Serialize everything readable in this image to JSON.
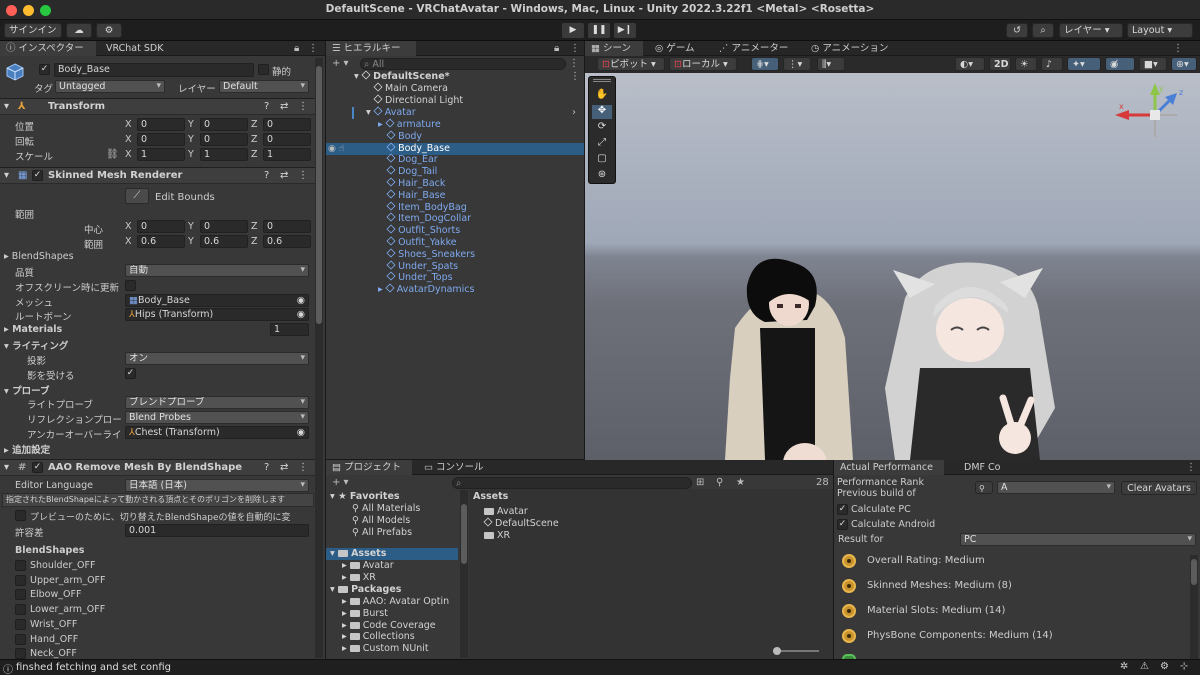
{
  "window": {
    "title": "DefaultScene - VRChatAvatar - Windows, Mac, Linux - Unity 2022.3.22f1 <Metal> <Rosetta>"
  },
  "toolbar": {
    "signin": "サインイン",
    "layers": "レイヤー",
    "layout": "Layout"
  },
  "inspector": {
    "tabs": [
      "インスペクター",
      "VRChat SDK"
    ],
    "object_name": "Body_Base",
    "static_label": "静的",
    "tag_label": "タグ",
    "tag_value": "Untagged",
    "layer_label": "レイヤー",
    "layer_value": "Default",
    "transform": {
      "title": "Transform",
      "rows": [
        {
          "label": "位置",
          "x": "0",
          "y": "0",
          "z": "0"
        },
        {
          "label": "回転",
          "x": "0",
          "y": "0",
          "z": "0"
        },
        {
          "label": "スケール",
          "x": "1",
          "y": "1",
          "z": "1"
        }
      ],
      "axis": [
        "X",
        "Y",
        "Z"
      ]
    },
    "smr": {
      "title": "Skinned Mesh Renderer",
      "edit_bounds": "Edit Bounds",
      "bounds_label": "範囲",
      "center_label": "中心",
      "center": [
        "0",
        "0",
        "0"
      ],
      "extent_label": "範囲",
      "extent": [
        "0.6",
        "0.6",
        "0.6"
      ],
      "blendshapes": "BlendShapes",
      "quality_label": "品質",
      "quality_value": "自動",
      "offscreen_label": "オフスクリーン時に更新",
      "mesh_label": "メッシュ",
      "mesh_value": "Body_Base",
      "rootbone_label": "ルートボーン",
      "rootbone_value": "Hips (Transform)",
      "materials_label": "Materials",
      "materials_count": "1",
      "lighting_label": "ライティング",
      "cast_label": "投影",
      "cast_value": "オン",
      "receive_label": "影を受ける",
      "probes_label": "プローブ",
      "lightprobe_label": "ライトプローブ",
      "lightprobe_value": "ブレンドプローブ",
      "reflection_label": "リフレクションプロー",
      "reflection_value": "Blend Probes",
      "anchor_label": "アンカーオーバーライ",
      "anchor_value": "Chest (Transform)",
      "extra_label": "追加設定"
    },
    "aao": {
      "title": "AAO Remove Mesh By BlendShape",
      "lang_label": "Editor Language",
      "lang_value": "日本語 (日本)",
      "info": "指定されたBlendShapeによって動かされる頂点とそのポリゴンを削除します",
      "preview": "プレビューのために、切り替えたBlendShapeの値を自動的に変",
      "tolerance_label": "許容差",
      "tolerance_value": "0.001",
      "blendshapes_label": "BlendShapes",
      "items": [
        "Shoulder_OFF",
        "Upper_arm_OFF",
        "Elbow_OFF",
        "Lower_arm_OFF",
        "Wrist_OFF",
        "Hand_OFF",
        "Neck_OFF"
      ]
    }
  },
  "hierarchy": {
    "tab": "ヒエラルキー",
    "search_placeholder": "All",
    "scene": "DefaultScene*",
    "items": [
      "Main Camera",
      "Directional Light"
    ],
    "avatar": "Avatar",
    "children": [
      "armature",
      "Body",
      "Body_Base",
      "Dog_Ear",
      "Dog_Tail",
      "Hair_Back",
      "Hair_Base",
      "Item_BodyBag",
      "Item_DogCollar",
      "Outfit_Shorts",
      "Outfit_Yakke",
      "Shoes_Sneakers",
      "Under_Spats",
      "Under_Tops",
      "AvatarDynamics"
    ]
  },
  "sceneview": {
    "tabs": [
      "シーン",
      "ゲーム",
      "アニメーター",
      "アニメーション"
    ],
    "pivot": "ピボット",
    "local": "ローカル",
    "mode2d": "2D",
    "gizmo_axes": {
      "x": "x",
      "y": "y",
      "z": "z"
    }
  },
  "project": {
    "tabs": [
      "プロジェクト",
      "コンソール"
    ],
    "favorites": "Favorites",
    "fav_items": [
      "All Materials",
      "All Models",
      "All Prefabs"
    ],
    "assets": "Assets",
    "asset_folders": [
      "Avatar",
      "XR"
    ],
    "packages": "Packages",
    "package_folders": [
      "AAO: Avatar Optin",
      "Burst",
      "Code Coverage",
      "Collections",
      "Custom NUnit"
    ],
    "right_header": "Assets",
    "right_items": [
      "Avatar",
      "DefaultScene",
      "XR"
    ],
    "count": "28"
  },
  "perf": {
    "tab": "Actual Performance",
    "tab_suffix": "DMF Co",
    "rank_line1": "Performance Rank",
    "rank_line2": "Previous build of",
    "select_value": "A",
    "clear_button": "Clear Avatars",
    "calc_pc": "Calculate PC",
    "calc_android": "Calculate Android",
    "result_label": "Result for",
    "result_value": "PC",
    "items": [
      "Overall Rating: Medium",
      "Skinned Meshes: Medium (8)",
      "Material Slots: Medium (14)",
      "PhysBone Components: Medium (14)"
    ]
  },
  "status": {
    "message": "finshed fetching and set config"
  },
  "colors": {
    "accent": "#2c5d87",
    "link_blue": "#7ea9ee",
    "medium": "#c8932c"
  }
}
